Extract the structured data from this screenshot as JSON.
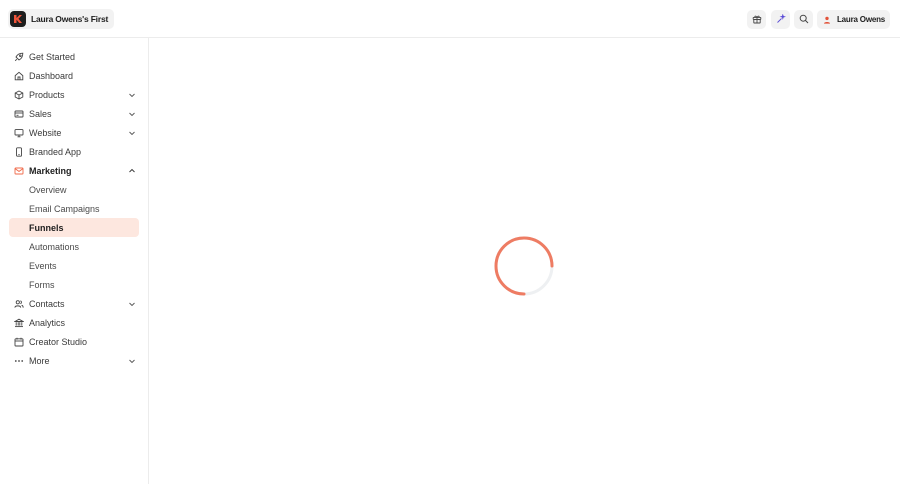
{
  "header": {
    "workspace_name": "Laura Owens's First",
    "user_name": "Laura Owens",
    "buttons": [
      {
        "name": "gift-icon"
      },
      {
        "name": "sparkle-icon"
      },
      {
        "name": "search-icon"
      }
    ]
  },
  "sidebar": {
    "items": [
      {
        "label": "Get Started",
        "icon": "rocket-icon",
        "has_chevron": false
      },
      {
        "label": "Dashboard",
        "icon": "home-icon",
        "has_chevron": false
      },
      {
        "label": "Products",
        "icon": "box-icon",
        "has_chevron": true
      },
      {
        "label": "Sales",
        "icon": "credit-card-icon",
        "has_chevron": true
      },
      {
        "label": "Website",
        "icon": "monitor-icon",
        "has_chevron": true
      },
      {
        "label": "Branded App",
        "icon": "phone-icon",
        "has_chevron": false
      },
      {
        "label": "Marketing",
        "icon": "mail-icon",
        "has_chevron": true,
        "expanded": true
      },
      {
        "label": "Contacts",
        "icon": "users-icon",
        "has_chevron": true
      },
      {
        "label": "Analytics",
        "icon": "bank-icon",
        "has_chevron": false
      },
      {
        "label": "Creator Studio",
        "icon": "calendar-icon",
        "has_chevron": false
      },
      {
        "label": "More",
        "icon": "more-icon",
        "has_chevron": true
      }
    ],
    "marketing_sub": [
      {
        "label": "Overview"
      },
      {
        "label": "Email Campaigns"
      },
      {
        "label": "Funnels",
        "active": true
      },
      {
        "label": "Automations"
      },
      {
        "label": "Events"
      },
      {
        "label": "Forms"
      }
    ]
  },
  "colors": {
    "accent": "#f06a4a",
    "active_bg": "#fde7df",
    "spinner": "#ee7c63"
  },
  "main": {
    "loading": true
  }
}
